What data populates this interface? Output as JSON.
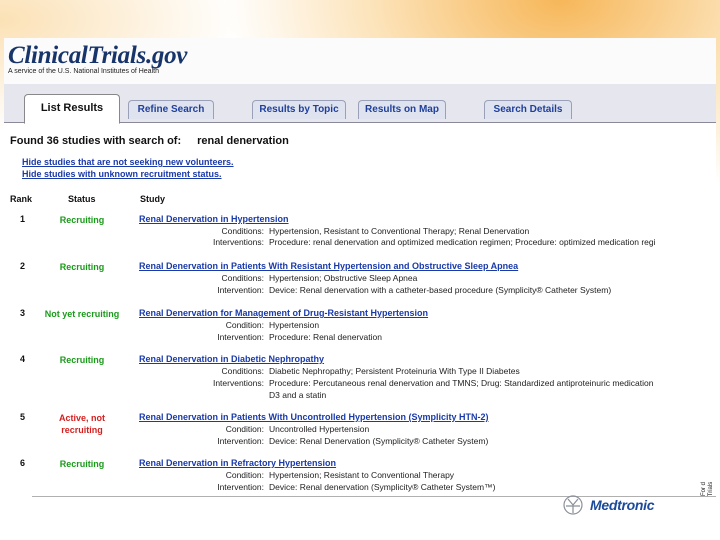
{
  "site": {
    "logo": "ClinicalTrials.gov",
    "tagline": "A service of the U.S. National Institutes of Health"
  },
  "tabs": [
    "List Results",
    "Refine Search",
    "Results by Topic",
    "Results on Map",
    "Search Details"
  ],
  "search": {
    "found_text": "Found 36 studies with search of:",
    "term": "renal denervation"
  },
  "links": {
    "hide_not_seeking": "Hide studies that are not seeking new volunteers.",
    "hide_unknown": "Hide studies with unknown recruitment status."
  },
  "columns": {
    "rank": "Rank",
    "status": "Status",
    "study": "Study"
  },
  "studies": [
    {
      "rank": "1",
      "status": "Recruiting",
      "title": "Renal Denervation in Hypertension",
      "l1": "Conditions:",
      "v1": "Hypertension, Resistant to Conventional Therapy;   Renal Denervation",
      "l2": "Interventions:",
      "v2": "Procedure: renal denervation and optimized medication regimen;   Procedure: optimized medication regi"
    },
    {
      "rank": "2",
      "status": "Recruiting",
      "title": "Renal Denervation in Patients With Resistant Hypertension and Obstructive Sleep Apnea",
      "l1": "Conditions:",
      "v1": "Hypertension;   Obstructive Sleep Apnea",
      "l2": "Intervention:",
      "v2": "Device: Renal denervation with a catheter-based procedure (Symplicity® Catheter System)"
    },
    {
      "rank": "3",
      "status": "Not yet recruiting",
      "title": "Renal Denervation for Management of Drug-Resistant Hypertension",
      "l1": "Condition:",
      "v1": "Hypertension",
      "l2": "Intervention:",
      "v2": "Procedure: Renal denervation"
    },
    {
      "rank": "4",
      "status": "Recruiting",
      "title": "Renal Denervation in Diabetic Nephropathy",
      "l1": "Conditions:",
      "v1": "Diabetic Nephropathy;   Persistent Proteinuria With Type II Diabetes",
      "l2": "Interventions:",
      "v2": "Procedure: Percutaneous renal denervation and TMNS;   Drug: Standardized antiproteinuric medication",
      "v3": "D3 and a statin"
    },
    {
      "rank": "5",
      "status_line1": "Active, not",
      "status_line2": "recruiting",
      "title": "Renal Denervation in Patients With Uncontrolled Hypertension (Symplicity HTN-2)",
      "l1": "Condition:",
      "v1": "Uncontrolled Hypertension",
      "l2": "Intervention:",
      "v2": "Device: Renal Denervation (Symplicity® Catheter System)"
    },
    {
      "rank": "6",
      "status": "Recruiting",
      "title": "Renal Denervation in Refractory Hypertension",
      "l1": "Condition:",
      "v1": "Hypertension; Resistant to Conventional Therapy",
      "l2": "Intervention:",
      "v2": "Device: Renal denervation (Symplicity® Catheter System™)"
    }
  ],
  "colors": {
    "recruiting": "#1a9a1a",
    "active_not_recruiting": "#d42020",
    "link": "#1a3aa8"
  },
  "footer": {
    "brand": "Medtronic",
    "side_text": "For d Trials"
  }
}
